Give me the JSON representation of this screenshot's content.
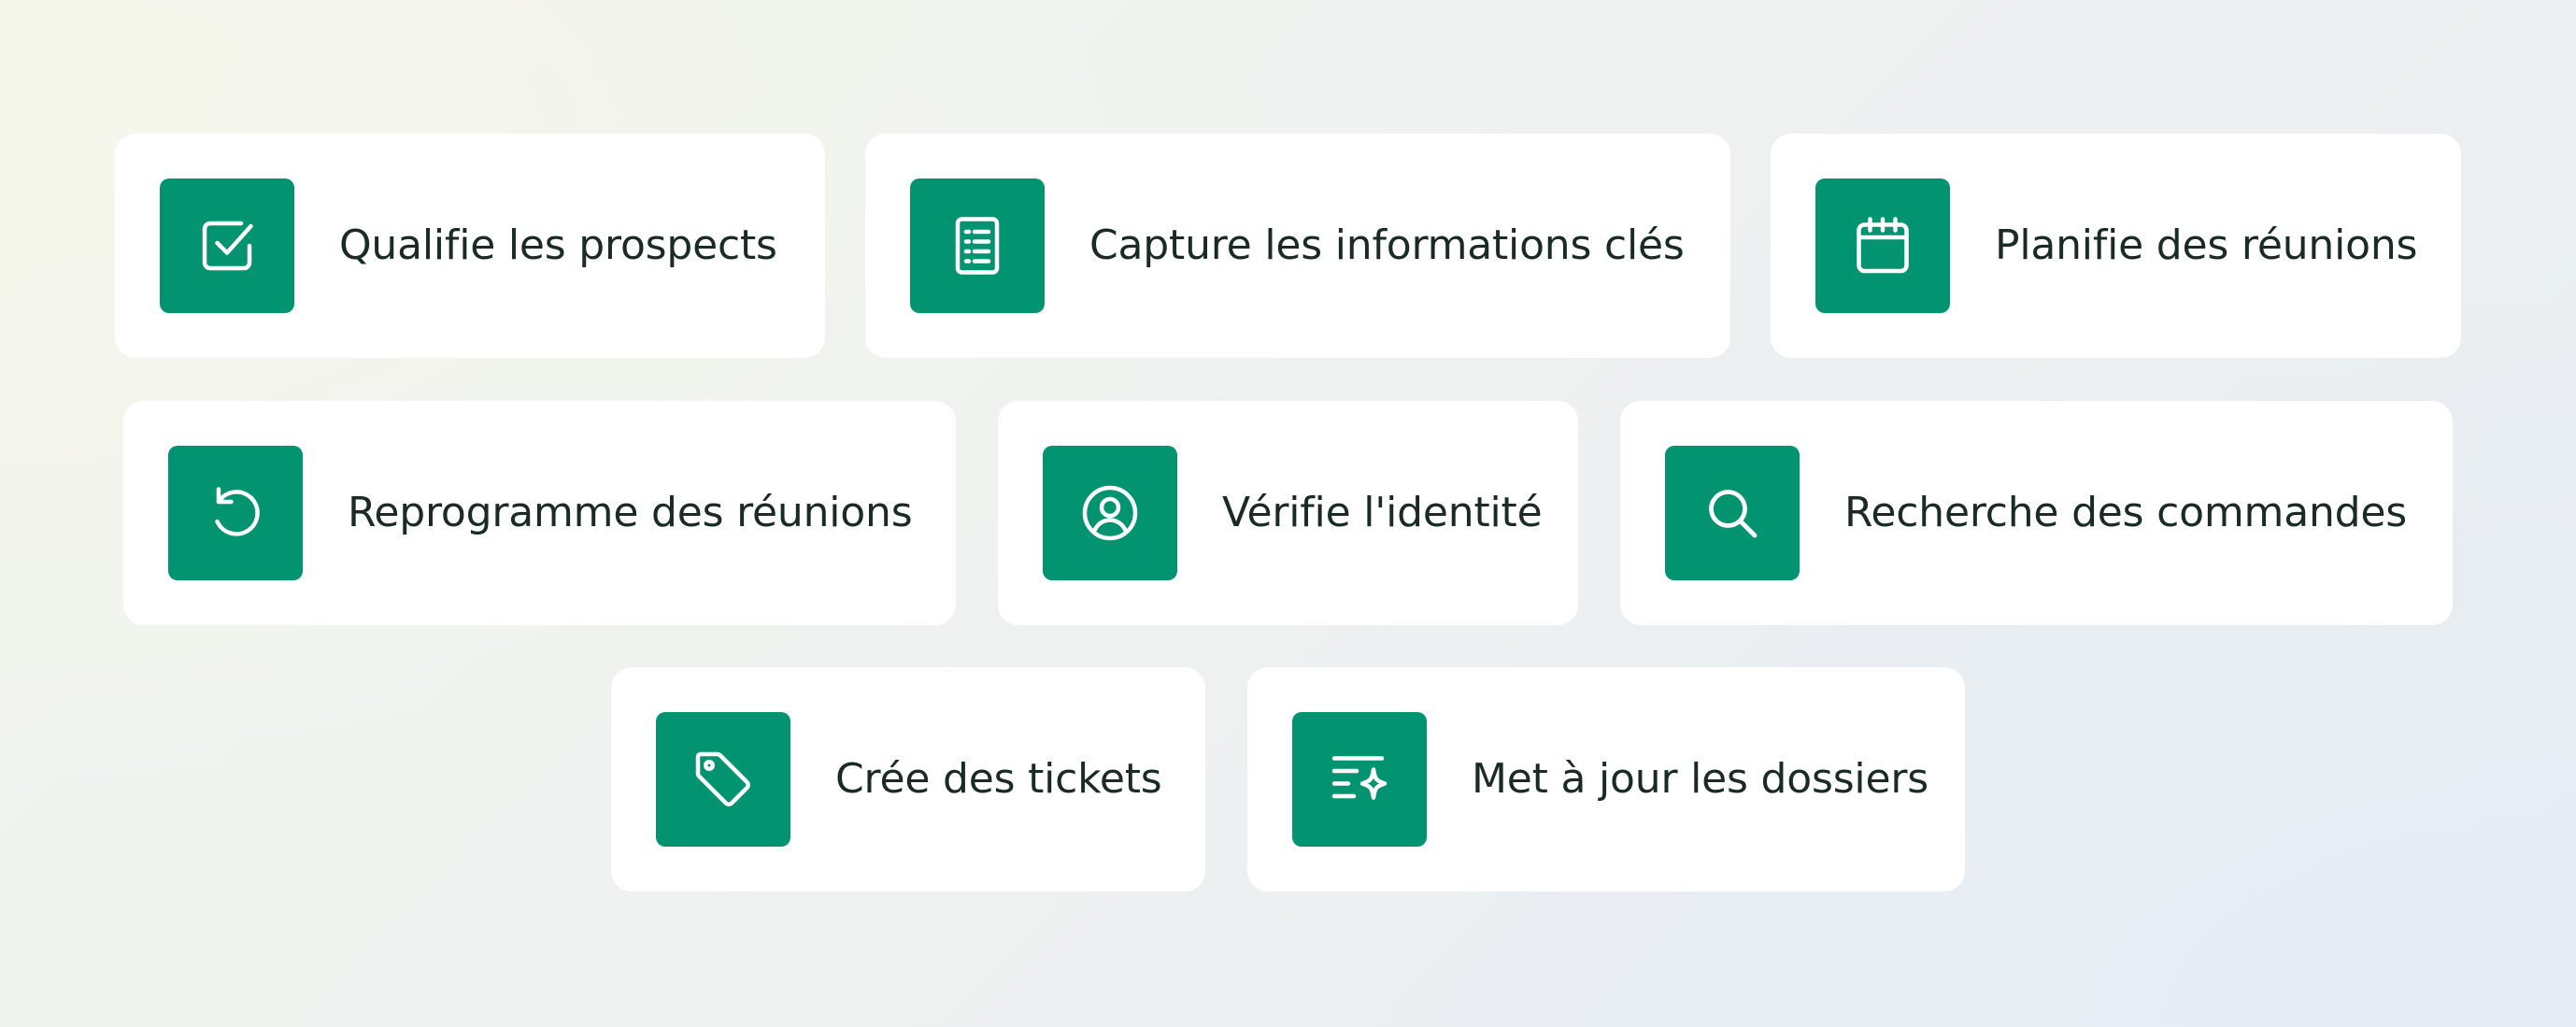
{
  "theme": {
    "accent": "#029370",
    "text": "#1a2b26",
    "card": "#ffffff"
  },
  "features": [
    {
      "icon": "checkbox-icon",
      "label": "Qualifie les prospects"
    },
    {
      "icon": "document-list-icon",
      "label": "Capture les informations clés"
    },
    {
      "icon": "calendar-icon",
      "label": "Planifie des réunions"
    },
    {
      "icon": "reschedule-arrow-icon",
      "label": "Reprogramme des réunions"
    },
    {
      "icon": "user-circle-icon",
      "label": "Vérifie l'identité"
    },
    {
      "icon": "search-icon",
      "label": "Recherche des commandes"
    },
    {
      "icon": "tag-icon",
      "label": "Crée des tickets"
    },
    {
      "icon": "sparkle-lines-icon",
      "label": "Met à jour les dossiers"
    }
  ]
}
